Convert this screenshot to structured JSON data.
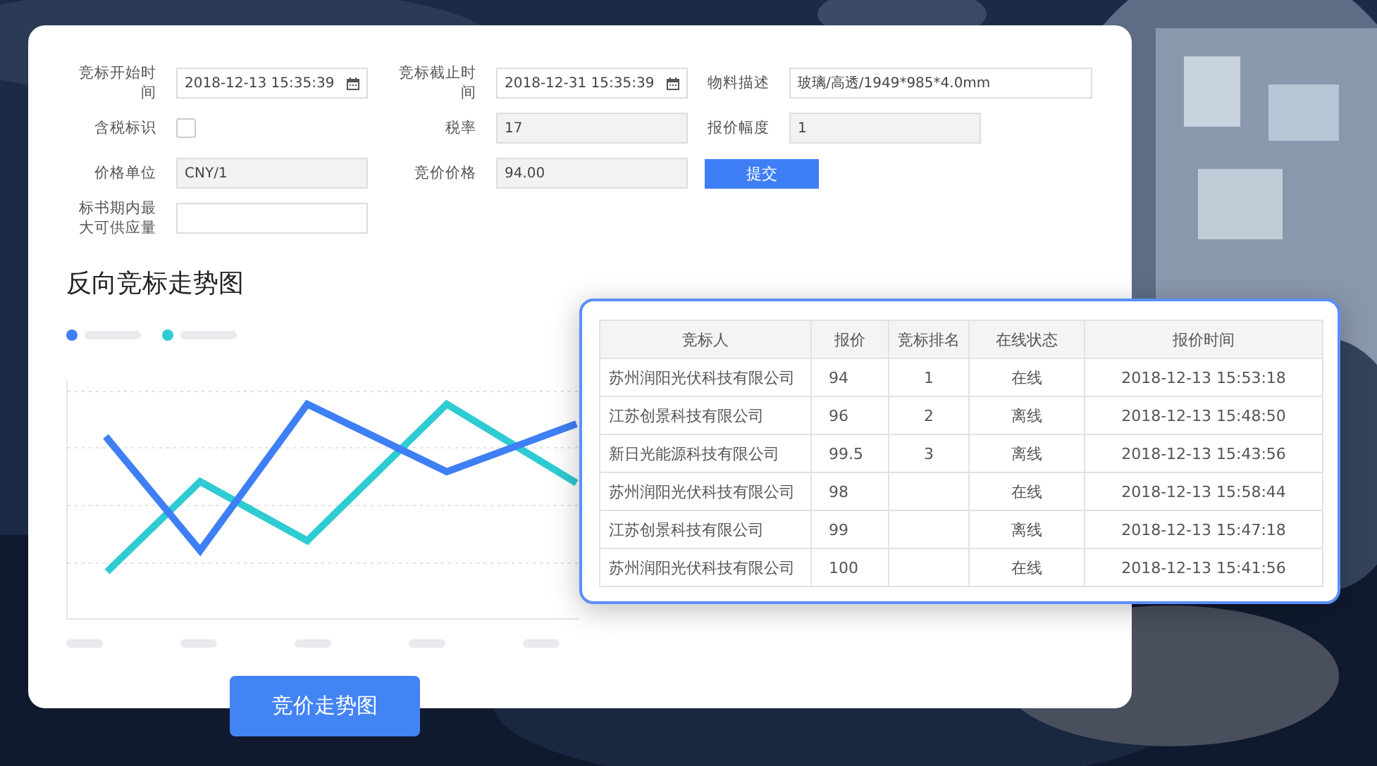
{
  "form": {
    "fields": [
      {
        "kind": "date",
        "label": "竞标开始时间",
        "value": "2018-12-13 15:35:39"
      },
      {
        "kind": "date",
        "label": "竞标截止时间",
        "value": "2018-12-31 15:35:39"
      },
      {
        "kind": "text",
        "label": "物料描述",
        "value": "玻璃/高透/1949*985*4.0mm"
      },
      {
        "kind": "checkbox",
        "label": "含税标识",
        "checked": false
      },
      {
        "kind": "readonly",
        "label": "税率",
        "value": "17"
      },
      {
        "kind": "readonly",
        "label": "报价幅度",
        "value": "1"
      },
      {
        "kind": "readonly",
        "label": "价格单位",
        "value": "CNY/1"
      },
      {
        "kind": "readonly",
        "label": "竞价价格",
        "value": "94.00"
      },
      {
        "kind": "button",
        "label": "提交"
      },
      {
        "kind": "text",
        "label": "标书期内最大可供应量"
      }
    ]
  },
  "chart": {
    "title": "反向竞标走势图"
  },
  "table": {
    "columns": [
      "竞标人",
      "报价",
      "竞标排名",
      "在线状态",
      "报价时间"
    ],
    "rows": [
      [
        "苏州润阳光伏科技有限公司",
        "94",
        "1",
        "在线",
        "2018-12-13 15:53:18"
      ],
      [
        "江苏创景科技有限公司",
        "96",
        "2",
        "离线",
        "2018-12-13 15:48:50"
      ],
      [
        "新日光能源科技有限公司",
        "99.5",
        "3",
        "离线",
        "2018-12-13 15:43:56"
      ],
      [
        "苏州润阳光伏科技有限公司",
        "98",
        "",
        "在线",
        "2018-12-13 15:58:44"
      ],
      [
        "江苏创景科技有限公司",
        "99",
        "",
        "离线",
        "2018-12-13 15:47:18"
      ],
      [
        "苏州润阳光伏科技有限公司",
        "100",
        "",
        "在线",
        "2018-12-13 15:41:56"
      ]
    ]
  },
  "bottom_button": {
    "label": "竞价走势图"
  }
}
